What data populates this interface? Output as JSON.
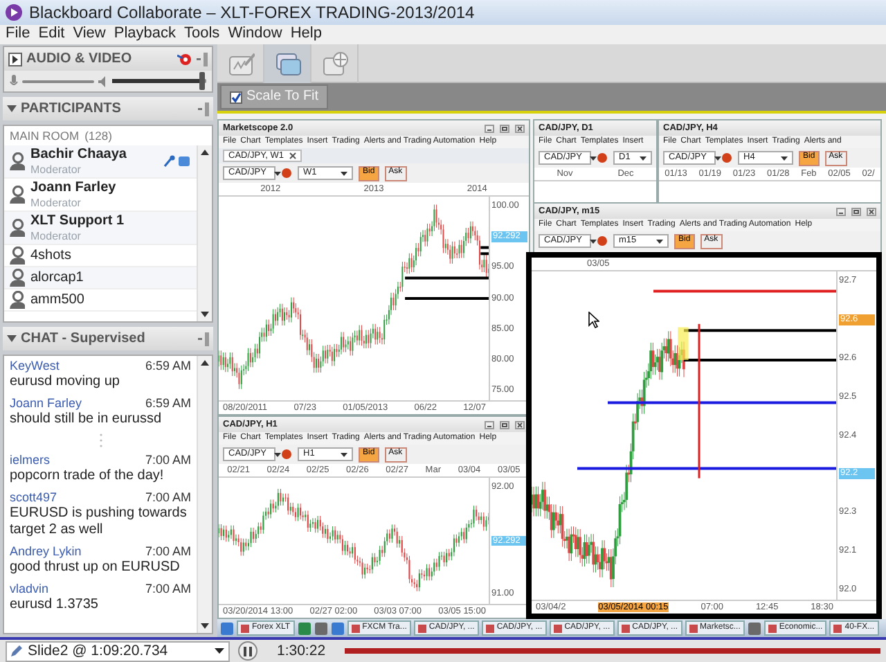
{
  "window": {
    "title": "Blackboard Collaborate – XLT-FOREX TRADING-2013/2014"
  },
  "menu": [
    "File",
    "Edit",
    "View",
    "Playback",
    "Tools",
    "Window",
    "Help"
  ],
  "audio_video": {
    "title": "AUDIO & VIDEO",
    "speaker": {
      "level": 0.95
    }
  },
  "participants": {
    "title": "PARTICIPANTS",
    "room": "MAIN ROOM",
    "count": "(128)",
    "people": [
      {
        "name": "Bachir Chaaya",
        "role": "Moderator",
        "mic_active": true
      },
      {
        "name": "Joann Farley",
        "role": "Moderator",
        "mic_active": false
      },
      {
        "name": "XLT Support 1",
        "role": "Moderator",
        "mic_active": false
      },
      {
        "name": "4shots",
        "mic_active": false
      },
      {
        "name": "alorcap1",
        "mic_active": false
      },
      {
        "name": "amm500",
        "mic_active": false
      }
    ]
  },
  "chat": {
    "title": "CHAT - Supervised",
    "messages": [
      {
        "kind": "message",
        "sender": "KeyWest",
        "time": "6:59 AM",
        "text": "eurusd moving up"
      },
      {
        "kind": "message",
        "sender": "Joann Farley",
        "time": "6:59 AM",
        "text": "should still be in eurussd"
      },
      {
        "kind": "gap"
      },
      {
        "kind": "message",
        "sender": "ielmers",
        "time": "7:00 AM",
        "text": "popcorn trade of the day!"
      },
      {
        "kind": "message",
        "sender": "scott497",
        "time": "7:00 AM",
        "text": "EURUSD is pushing towards target 2 as well"
      },
      {
        "kind": "message",
        "sender": "Andrey Lykin",
        "time": "7:00 AM",
        "text": "good thrust up on EURUSD"
      },
      {
        "kind": "message",
        "sender": "vladvin",
        "time": "7:00 AM",
        "text": "eurusd 1.3735"
      }
    ]
  },
  "toolbar": [
    {
      "kind": "whiteboard",
      "selected": false
    },
    {
      "kind": "app_share",
      "selected": true
    },
    {
      "kind": "web_tour",
      "selected": false
    }
  ],
  "scale_to_fit": {
    "label": "Scale To Fit",
    "checked": true
  },
  "chart_windows": [
    {
      "kind": "full",
      "title": "Marketscope 2.0",
      "menu": [
        "File",
        "Chart",
        "Templates",
        "Insert",
        "Trading",
        "Alerts and Trading Automation",
        "Help"
      ],
      "tab": "CAD/JPY, W1",
      "symbol": "CAD/JPY",
      "period": "W1",
      "buttons": [
        "Bid",
        "Ask"
      ],
      "top_labels": [
        "2012",
        "2013",
        "2014"
      ],
      "y_labels": [
        "100.00",
        "95.00",
        "90.00",
        "85.00",
        "80.00",
        "75.00"
      ],
      "price_tag": "92.292",
      "x_labels": [
        "08/20/2011",
        "07/23",
        "01/05/2013",
        "06/22",
        "12/07"
      ]
    },
    {
      "kind": "full",
      "title": "CAD/JPY, H1",
      "menu": [
        "File",
        "Chart",
        "Templates",
        "Insert",
        "Trading",
        "Alerts and Trading Automation",
        "Help"
      ],
      "symbol": "CAD/JPY",
      "period": "H1",
      "buttons": [
        "Bid",
        "Ask"
      ],
      "top_labels": [
        "02/21",
        "02/24",
        "02/25",
        "02/26",
        "02/27",
        "Mar",
        "03/04",
        "03/05"
      ],
      "y_labels": [
        "92.00",
        "91.00"
      ],
      "price_tag": "92.292",
      "x_labels": [
        "03/20/2014 13:00",
        "02/27 02:00",
        "03/03 07:00",
        "03/05 15:00"
      ]
    },
    {
      "kind": "ruler",
      "title": "CAD/JPY, D1",
      "menu": [
        "File",
        "Chart",
        "Templates",
        "Insert"
      ],
      "symbol": "CAD/JPY",
      "period": "D1",
      "top_labels": [
        "Nov",
        "Dec"
      ]
    },
    {
      "kind": "ruler",
      "title": "CAD/JPY, H4",
      "menu": [
        "File",
        "Chart",
        "Templates",
        "Insert",
        "Trading",
        "Alerts and"
      ],
      "symbol": "CAD/JPY",
      "period": "H4",
      "buttons": [
        "Bid",
        "Ask"
      ],
      "top_labels": [
        "01/13",
        "01/19",
        "01/23",
        "01/28",
        "Feb",
        "02/05",
        "02/"
      ]
    },
    {
      "kind": "header",
      "title": "CAD/JPY, m15",
      "menu": [
        "File",
        "Chart",
        "Templates",
        "Insert",
        "Trading",
        "Alerts and Trading Automation",
        "Help"
      ],
      "symbol": "CAD/JPY",
      "period": "m15",
      "buttons": [
        "Bid",
        "Ask"
      ]
    }
  ],
  "zoom_chart": {
    "top_label": "03/05",
    "y_labels": [
      "92.7",
      "92.6",
      "92.5",
      "92.4",
      "92.3",
      "92.1",
      "92.0"
    ],
    "tags": [
      {
        "text": "92.6",
        "color": "#f0a030"
      },
      {
        "text": "92.2",
        "color": "#6cc4f0"
      }
    ],
    "x_labels": [
      {
        "text": "03/04/2",
        "selected": false
      },
      {
        "text": "03/05/2014 00:15",
        "selected": true
      },
      {
        "text": "07:00",
        "selected": false
      },
      {
        "text": "12:45",
        "selected": false
      },
      {
        "text": "18:30",
        "selected": false
      }
    ]
  },
  "taskbar": [
    {
      "kind": "icon"
    },
    {
      "kind": "app",
      "label": "Forex XLT"
    },
    {
      "kind": "icon"
    },
    {
      "kind": "icon"
    },
    {
      "kind": "icon"
    },
    {
      "kind": "app",
      "label": "FXCM Tra..."
    },
    {
      "kind": "app",
      "label": "CAD/JPY, ..."
    },
    {
      "kind": "app",
      "label": "CAD/JPY, ..."
    },
    {
      "kind": "app",
      "label": "CAD/JPY, ..."
    },
    {
      "kind": "app",
      "label": "CAD/JPY, ..."
    },
    {
      "kind": "app",
      "label": "Marketsc..."
    },
    {
      "kind": "icon"
    },
    {
      "kind": "app",
      "label": "Economic..."
    },
    {
      "kind": "app",
      "label": "40-FX..."
    }
  ],
  "playback": {
    "slide": "Slide2 @ 1:09:20.734",
    "time": "1:30:22"
  }
}
